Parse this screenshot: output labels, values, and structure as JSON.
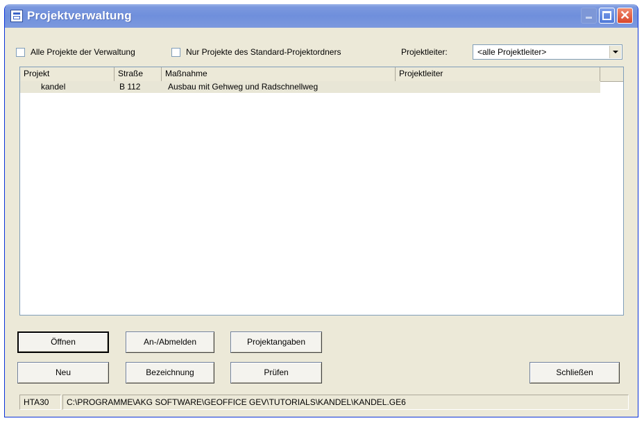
{
  "window": {
    "title": "Projektverwaltung"
  },
  "filters": {
    "all_projects_label": "Alle Projekte der Verwaltung",
    "standard_folder_label": "Nur Projekte des Standard-Projektordners",
    "manager_label": "Projektleiter:",
    "manager_value": "<alle Projektleiter>"
  },
  "table": {
    "columns": [
      "Projekt",
      "Straße",
      "Maßnahme",
      "Projektleiter"
    ],
    "rows": [
      {
        "projekt": "kandel",
        "strasse": "B 112",
        "massnahme": "Ausbau mit Gehweg und Radschnellweg",
        "projektleiter": ""
      }
    ]
  },
  "buttons": {
    "open": "Öffnen",
    "register": "An-/Abmelden",
    "project_info": "Projektangaben",
    "new": "Neu",
    "rename": "Bezeichnung",
    "check": "Prüfen",
    "close": "Schließen"
  },
  "status": {
    "code": "HTA30",
    "path": "C:\\PROGRAMME\\AKG SOFTWARE\\GEOFFICE GEV\\TUTORIALS\\KANDEL\\KANDEL.GE6"
  }
}
